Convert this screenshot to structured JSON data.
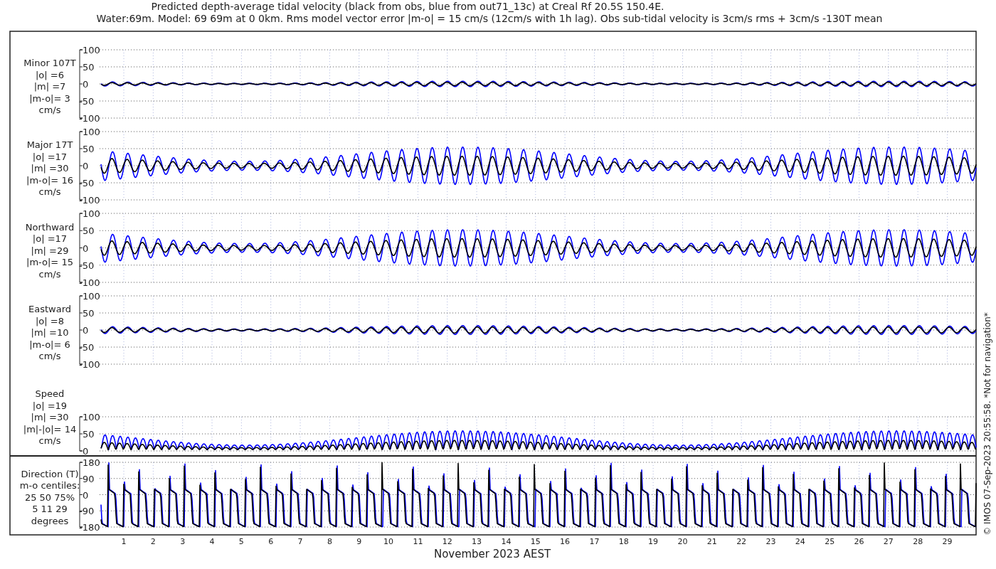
{
  "title": {
    "line_1": "Predicted depth-average tidal velocity (black from obs, blue from out71_13c) at Creal Rf 20.5S 150.4E.",
    "line_2": "Water:69m. Model: 69 69m at 0 0km. Rms model vector error |m-o| = 15 cm/s (12cm/s with 1h lag). Obs sub-tidal velocity is 3cm/s rms + 3cm/s -130T mean"
  },
  "panels": [
    {
      "kind": "velocity",
      "label": [
        "Minor 107T",
        "|o| =6",
        "|m| =7",
        "|m-o|= 3",
        "cm/s"
      ],
      "yticks": [
        "100",
        "50",
        "0",
        "-50",
        "-100"
      ]
    },
    {
      "kind": "velocity",
      "label": [
        "Major 17T",
        "|o| =17",
        "|m| =30",
        "|m-o|= 16",
        "cm/s"
      ],
      "yticks": [
        "100",
        "50",
        "0",
        "-50",
        "-100"
      ]
    },
    {
      "kind": "velocity",
      "label": [
        "Northward",
        "|o| =17",
        "|m| =29",
        "|m-o|= 15",
        "cm/s"
      ],
      "yticks": [
        "100",
        "50",
        "0",
        "-50",
        "-100"
      ]
    },
    {
      "kind": "velocity",
      "label": [
        "Eastward",
        "|o| =8",
        "|m| =10",
        "|m-o|= 6",
        "cm/s"
      ],
      "yticks": [
        "100",
        "50",
        "0",
        "-50",
        "-100"
      ]
    },
    {
      "kind": "speed",
      "label": [
        "Speed",
        "|o| =19",
        "|m| =30",
        "|m|-|o|= 14",
        "cm/s"
      ],
      "yticks": [
        "100",
        "50",
        "0"
      ]
    },
    {
      "kind": "direction",
      "label": [
        "Direction (T)",
        "m-o centiles:",
        "25  50  75%",
        "5  11  29",
        "degrees"
      ],
      "yticks": [
        "180",
        "90",
        "0",
        "-90",
        "-180"
      ]
    }
  ],
  "x_axis": {
    "ticks": [
      "1",
      "2",
      "3",
      "4",
      "5",
      "6",
      "7",
      "8",
      "9",
      "10",
      "11",
      "12",
      "13",
      "14",
      "15",
      "16",
      "17",
      "18",
      "19",
      "20",
      "21",
      "22",
      "23",
      "24",
      "25",
      "26",
      "27",
      "28",
      "29"
    ],
    "label": "November 2023 AEST"
  },
  "credit": "© IMOS 07-Sep-2023 20:55:58. *Not for navigation*"
}
